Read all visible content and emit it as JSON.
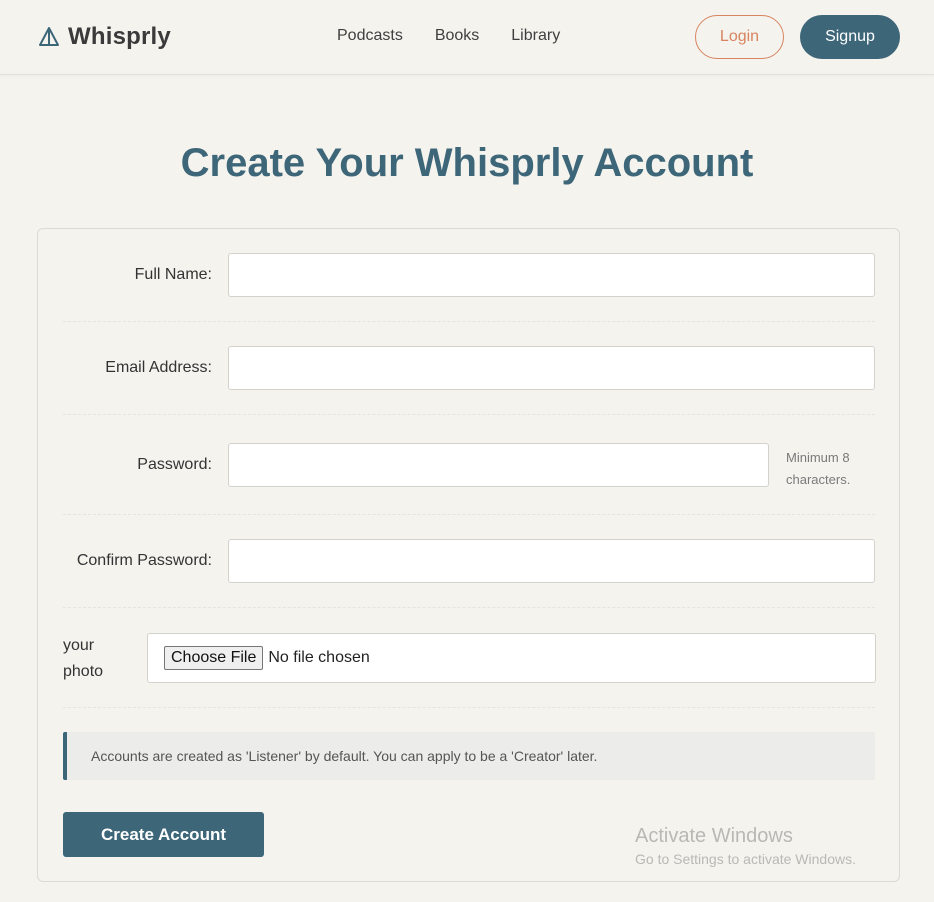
{
  "header": {
    "brand": "Whisprly",
    "nav": [
      "Podcasts",
      "Books",
      "Library"
    ],
    "login_label": "Login",
    "signup_label": "Signup"
  },
  "page_title": "Create Your Whisprly Account",
  "form": {
    "full_name_label": "Full Name:",
    "full_name_value": "",
    "email_label": "Email Address:",
    "email_value": "",
    "password_label": "Password:",
    "password_value": "",
    "password_hint": "Minimum 8 characters.",
    "confirm_label": "Confirm Password:",
    "confirm_value": "",
    "photo_label": "your photo",
    "file_button": "Choose File",
    "file_status": "No file chosen",
    "info_text": "Accounts are created as 'Listener' by default. You can apply to be a 'Creator' later.",
    "submit_label": "Create Account"
  },
  "watermark": {
    "title": "Activate Windows",
    "subtitle": "Go to Settings to activate Windows."
  },
  "colors": {
    "background": "#f5f3ee",
    "primary": "#3d6679",
    "accent": "#d7845f"
  },
  "icons": {
    "brand": "sailboat-icon"
  }
}
